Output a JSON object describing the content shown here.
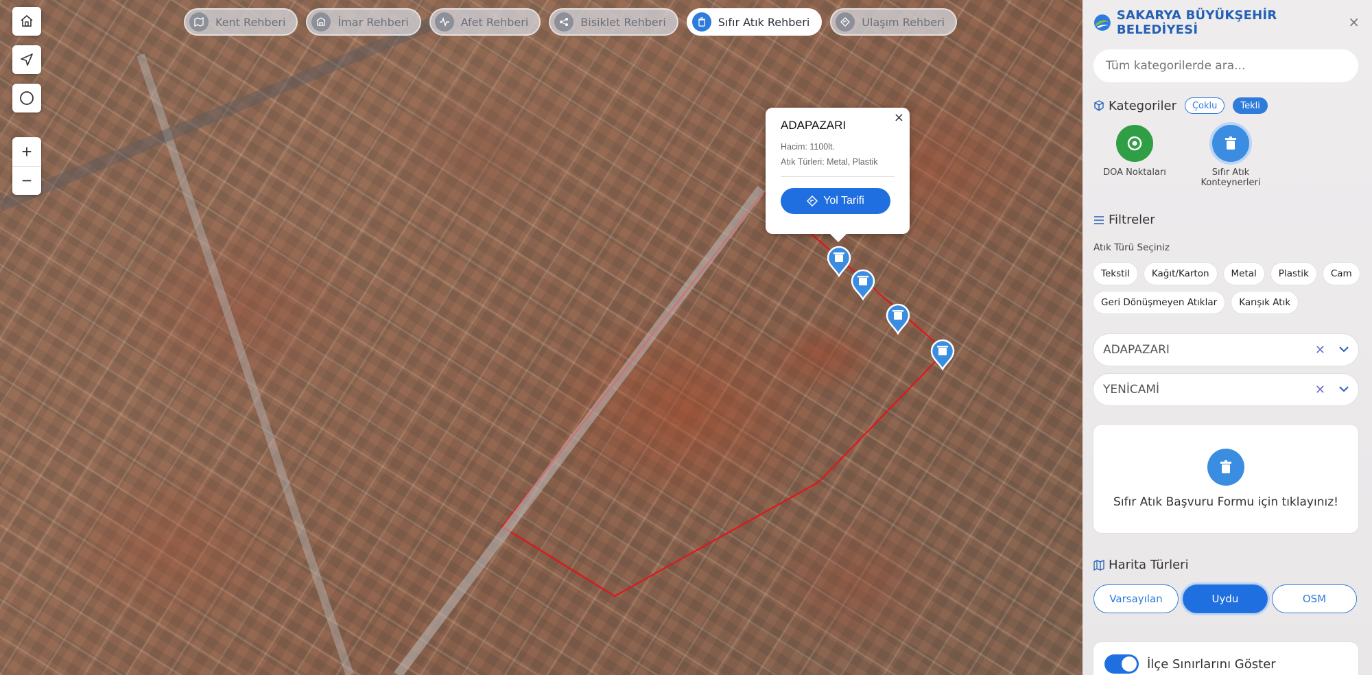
{
  "tabs": [
    {
      "label": "Kent Rehberi",
      "icon": "map-icon",
      "active": false
    },
    {
      "label": "İmar Rehberi",
      "icon": "building-icon",
      "active": false
    },
    {
      "label": "Afet Rehberi",
      "icon": "pulse-icon",
      "active": false
    },
    {
      "label": "Bisiklet Rehberi",
      "icon": "share-icon",
      "active": false
    },
    {
      "label": "Sıfır Atık Rehberi",
      "icon": "trash-icon",
      "active": true
    },
    {
      "label": "Ulaşım Rehberi",
      "icon": "direction-icon",
      "active": false
    }
  ],
  "controls": {
    "zoom_in": "+",
    "zoom_out": "−"
  },
  "popup": {
    "title": "ADAPAZARI",
    "volume": "Hacim: 1100lt.",
    "waste_types": "Atık Türleri: Metal, Plastik",
    "route_button": "Yol Tarifi",
    "close": "×"
  },
  "sidebar": {
    "title": "SAKARYA BÜYÜKŞEHİR BELEDİYESİ",
    "close": "×",
    "search_placeholder": "Tüm kategorilerde ara...",
    "categories_title": "Kategoriler",
    "mode_multi": "Çoklu",
    "mode_single": "Tekli",
    "categories": [
      {
        "label": "DOA Noktaları",
        "color": "#2f9e45"
      },
      {
        "label": "Sıfır Atık Konteynerleri",
        "color": "#3a8de0"
      }
    ],
    "filters_title": "Filtreler",
    "waste_type_label": "Atık Türü Seçiniz",
    "waste_types": [
      "Tekstil",
      "Kağıt/Karton",
      "Metal",
      "Plastik",
      "Cam",
      "Geri Dönüşmeyen Atıklar",
      "Karışık Atık"
    ],
    "district": "ADAPAZARI",
    "neighborhood": "YENİCAMİ",
    "form_text": "Sıfır Atık Başvuru Formu için tıklayınız!",
    "map_types_title": "Harita Türleri",
    "map_types": [
      "Varsayılan",
      "Uydu",
      "OSM"
    ],
    "map_type_selected": "Uydu",
    "toggle_label": "İlçe Sınırlarını Göster",
    "toggle_on": true
  },
  "colors": {
    "accent": "#1f6fe0",
    "boundary": "#e0161b",
    "brand": "#2460b5"
  }
}
